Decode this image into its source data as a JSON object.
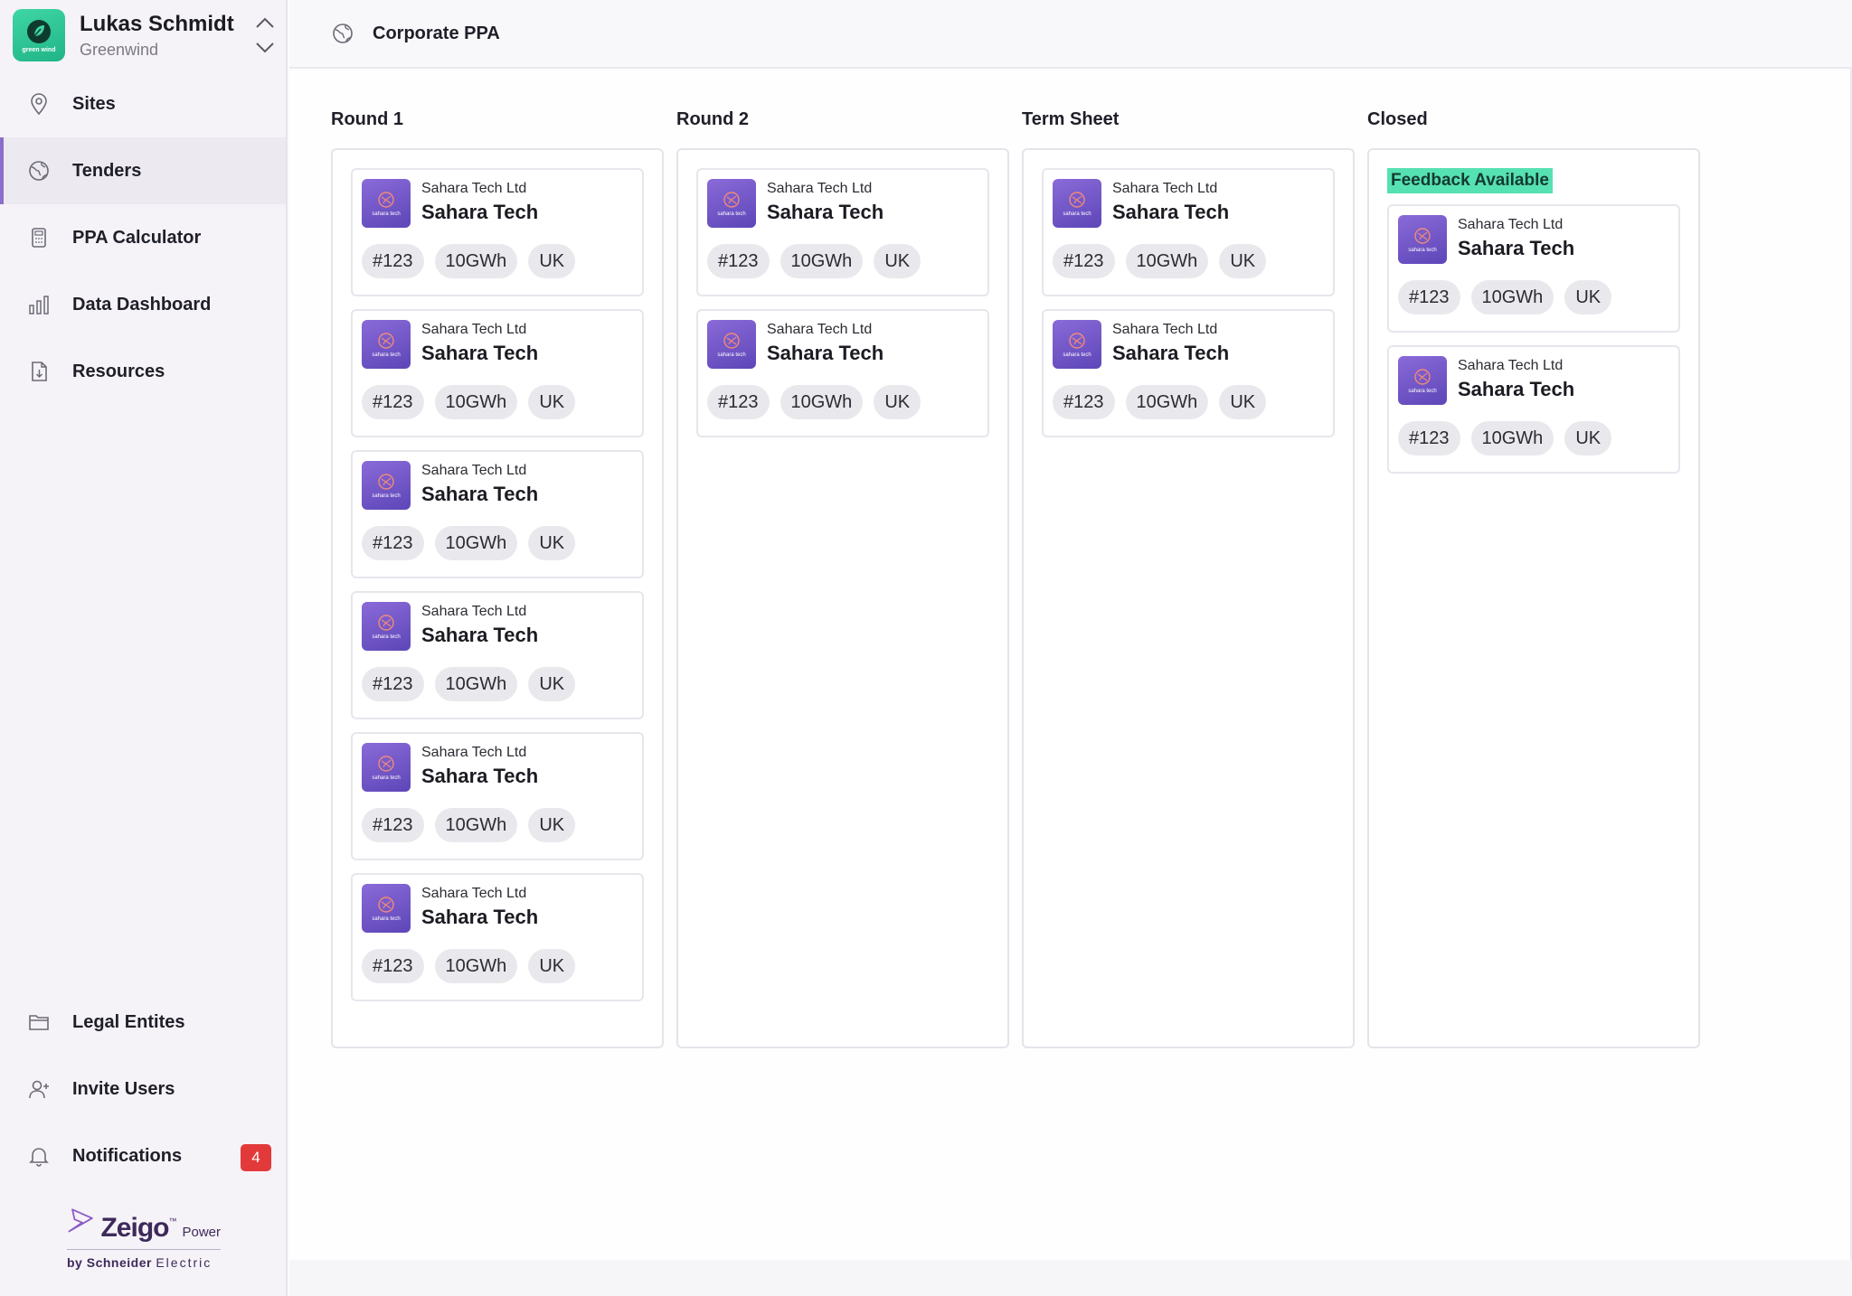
{
  "user": {
    "name": "Lukas Schmidt",
    "org": "Greenwind",
    "logo_text": "green wind"
  },
  "nav_top": [
    {
      "label": "Sites",
      "icon": "location-pin-icon"
    },
    {
      "label": "Tenders",
      "icon": "globe-icon",
      "active": true
    },
    {
      "label": "PPA Calculator",
      "icon": "calculator-icon"
    },
    {
      "label": "Data Dashboard",
      "icon": "bar-chart-icon"
    },
    {
      "label": "Resources",
      "icon": "document-download-icon"
    }
  ],
  "nav_bottom": [
    {
      "label": "Legal Entites",
      "icon": "folder-icon"
    },
    {
      "label": "Invite Users",
      "icon": "user-add-icon"
    },
    {
      "label": "Notifications",
      "icon": "bell-icon",
      "badge": "4"
    }
  ],
  "brand": {
    "name": "Zeigo",
    "tm": "™",
    "suffix": "Power",
    "by": "by",
    "company": "Schneider",
    "company2": "Electric"
  },
  "header": {
    "title": "Corporate PPA",
    "icon": "globe-icon"
  },
  "colors": {
    "accent": "#8b6fc9",
    "feedback": "#56e1b2",
    "badge": "#e23a3a",
    "card_logo": "#6a52c4"
  },
  "columns": [
    {
      "title": "Round 1",
      "cards": [
        {
          "company": "Sahara Tech Ltd",
          "name": "Sahara Tech",
          "logo_text": "sahara tech",
          "tags": [
            "#123",
            "10GWh",
            "UK"
          ]
        },
        {
          "company": "Sahara Tech Ltd",
          "name": "Sahara Tech",
          "logo_text": "sahara tech",
          "tags": [
            "#123",
            "10GWh",
            "UK"
          ]
        },
        {
          "company": "Sahara Tech Ltd",
          "name": "Sahara Tech",
          "logo_text": "sahara tech",
          "tags": [
            "#123",
            "10GWh",
            "UK"
          ]
        },
        {
          "company": "Sahara Tech Ltd",
          "name": "Sahara Tech",
          "logo_text": "sahara tech",
          "tags": [
            "#123",
            "10GWh",
            "UK"
          ]
        },
        {
          "company": "Sahara Tech Ltd",
          "name": "Sahara Tech",
          "logo_text": "sahara tech",
          "tags": [
            "#123",
            "10GWh",
            "UK"
          ]
        },
        {
          "company": "Sahara Tech Ltd",
          "name": "Sahara Tech",
          "logo_text": "sahara tech",
          "tags": [
            "#123",
            "10GWh",
            "UK"
          ]
        }
      ]
    },
    {
      "title": "Round 2",
      "cards": [
        {
          "company": "Sahara Tech Ltd",
          "name": "Sahara Tech",
          "logo_text": "sahara tech",
          "tags": [
            "#123",
            "10GWh",
            "UK"
          ]
        },
        {
          "company": "Sahara Tech Ltd",
          "name": "Sahara Tech",
          "logo_text": "sahara tech",
          "tags": [
            "#123",
            "10GWh",
            "UK"
          ]
        }
      ]
    },
    {
      "title": "Term Sheet",
      "cards": [
        {
          "company": "Sahara Tech Ltd",
          "name": "Sahara Tech",
          "logo_text": "sahara tech",
          "tags": [
            "#123",
            "10GWh",
            "UK"
          ]
        },
        {
          "company": "Sahara Tech Ltd",
          "name": "Sahara Tech",
          "logo_text": "sahara tech",
          "tags": [
            "#123",
            "10GWh",
            "UK"
          ]
        }
      ]
    },
    {
      "title": "Closed",
      "badge": "Feedback Available",
      "cards": [
        {
          "company": "Sahara Tech Ltd",
          "name": "Sahara Tech",
          "logo_text": "sahara tech",
          "tags": [
            "#123",
            "10GWh",
            "UK"
          ]
        },
        {
          "company": "Sahara Tech Ltd",
          "name": "Sahara Tech",
          "logo_text": "sahara tech",
          "tags": [
            "#123",
            "10GWh",
            "UK"
          ]
        }
      ]
    }
  ]
}
